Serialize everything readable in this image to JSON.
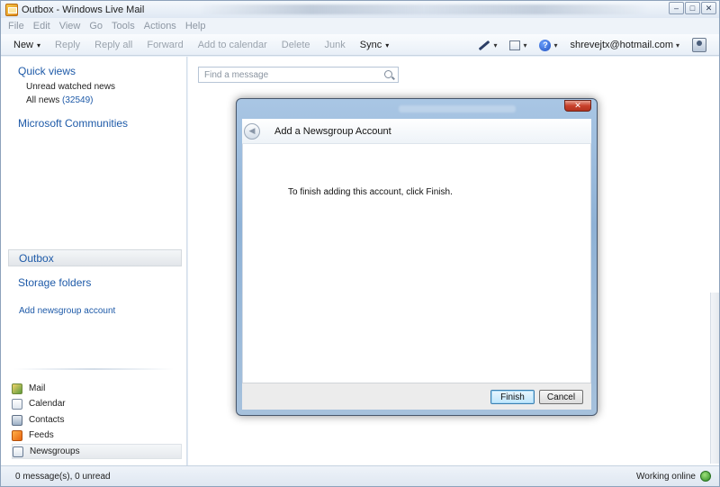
{
  "window": {
    "title": "Outbox - Windows Live Mail",
    "minimize": "–",
    "maximize": "□",
    "close": "✕"
  },
  "menu": [
    "File",
    "Edit",
    "View",
    "Go",
    "Tools",
    "Actions",
    "Help"
  ],
  "toolbar": {
    "new_label": "New",
    "reply_label": "Reply",
    "reply_all_label": "Reply all",
    "forward_label": "Forward",
    "add_to_calendar_label": "Add to calendar",
    "delete_label": "Delete",
    "junk_label": "Junk",
    "sync_label": "Sync",
    "caret": "▾",
    "help_glyph": "?",
    "user": "shrevejtx@hotmail.com"
  },
  "sidebar": {
    "quick_views": "Quick views",
    "unread_watched": "Unread watched news",
    "all_news": "All news",
    "all_news_count": "(32549)",
    "microsoft_communities": "Microsoft Communities",
    "outbox": "Outbox",
    "storage_folders": "Storage folders",
    "add_newsgroup_account": "Add newsgroup account",
    "nav": {
      "mail": "Mail",
      "calendar": "Calendar",
      "contacts": "Contacts",
      "feeds": "Feeds",
      "newsgroups": "Newsgroups"
    }
  },
  "search": {
    "placeholder": "Find a message"
  },
  "status": {
    "messages": "0 message(s), 0 unread",
    "online": "Working online"
  },
  "dialog": {
    "close": "✕",
    "back": "◀",
    "title": "Add a Newsgroup Account",
    "message": "To finish adding this account, click Finish.",
    "finish_label": "Finish",
    "cancel_label": "Cancel"
  }
}
